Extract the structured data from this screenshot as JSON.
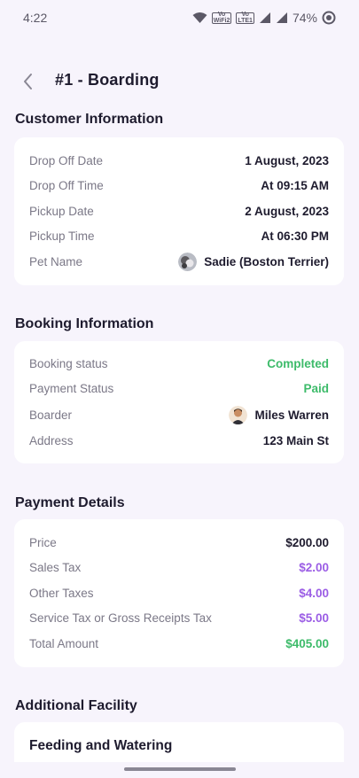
{
  "status_bar": {
    "time": "4:22",
    "battery": "74%",
    "icons": [
      "wifi-icon",
      "volte-wifi2-badge",
      "volte-lte1-badge",
      "signal-icon",
      "signal-icon",
      "battery-icon"
    ],
    "badges": {
      "vo_wifi": [
        "Vo",
        "WiFi2"
      ],
      "vo_lte": [
        "Vo",
        "LTE1"
      ]
    }
  },
  "header": {
    "title": "#1 - Boarding",
    "back_icon": "chevron-left-icon"
  },
  "customer_info": {
    "title": "Customer Information",
    "rows": [
      {
        "label": "Drop Off Date",
        "value": "1 August, 2023"
      },
      {
        "label": "Drop Off Time",
        "value": "At 09:15 AM"
      },
      {
        "label": "Pickup Date",
        "value": "2 August, 2023"
      },
      {
        "label": "Pickup Time",
        "value": "At 06:30 PM"
      },
      {
        "label": "Pet Name",
        "value": "Sadie (Boston Terrier)"
      }
    ]
  },
  "booking_info": {
    "title": "Booking Information",
    "rows": [
      {
        "label": "Booking status",
        "value": "Completed"
      },
      {
        "label": "Payment Status",
        "value": "Paid"
      },
      {
        "label": "Boarder",
        "value": "Miles Warren"
      },
      {
        "label": "Address",
        "value": "123 Main St"
      }
    ]
  },
  "payment_details": {
    "title": "Payment Details",
    "rows": [
      {
        "label": "Price",
        "value": "$200.00"
      },
      {
        "label": "Sales Tax",
        "value": "$2.00"
      },
      {
        "label": "Other Taxes",
        "value": "$4.00"
      },
      {
        "label": "Service Tax or Gross Receipts Tax",
        "value": "$5.00"
      },
      {
        "label": "Total Amount",
        "value": "$405.00"
      }
    ]
  },
  "additional_facility": {
    "title": "Additional Facility",
    "items": [
      {
        "title": "Feeding and Watering"
      }
    ]
  },
  "colors": {
    "background": "#f7f4fc",
    "card": "#ffffff",
    "green": "#3dbb6a",
    "purple": "#9b5de5",
    "text_dark": "#1e1b2e",
    "text_muted": "#7b7887"
  }
}
